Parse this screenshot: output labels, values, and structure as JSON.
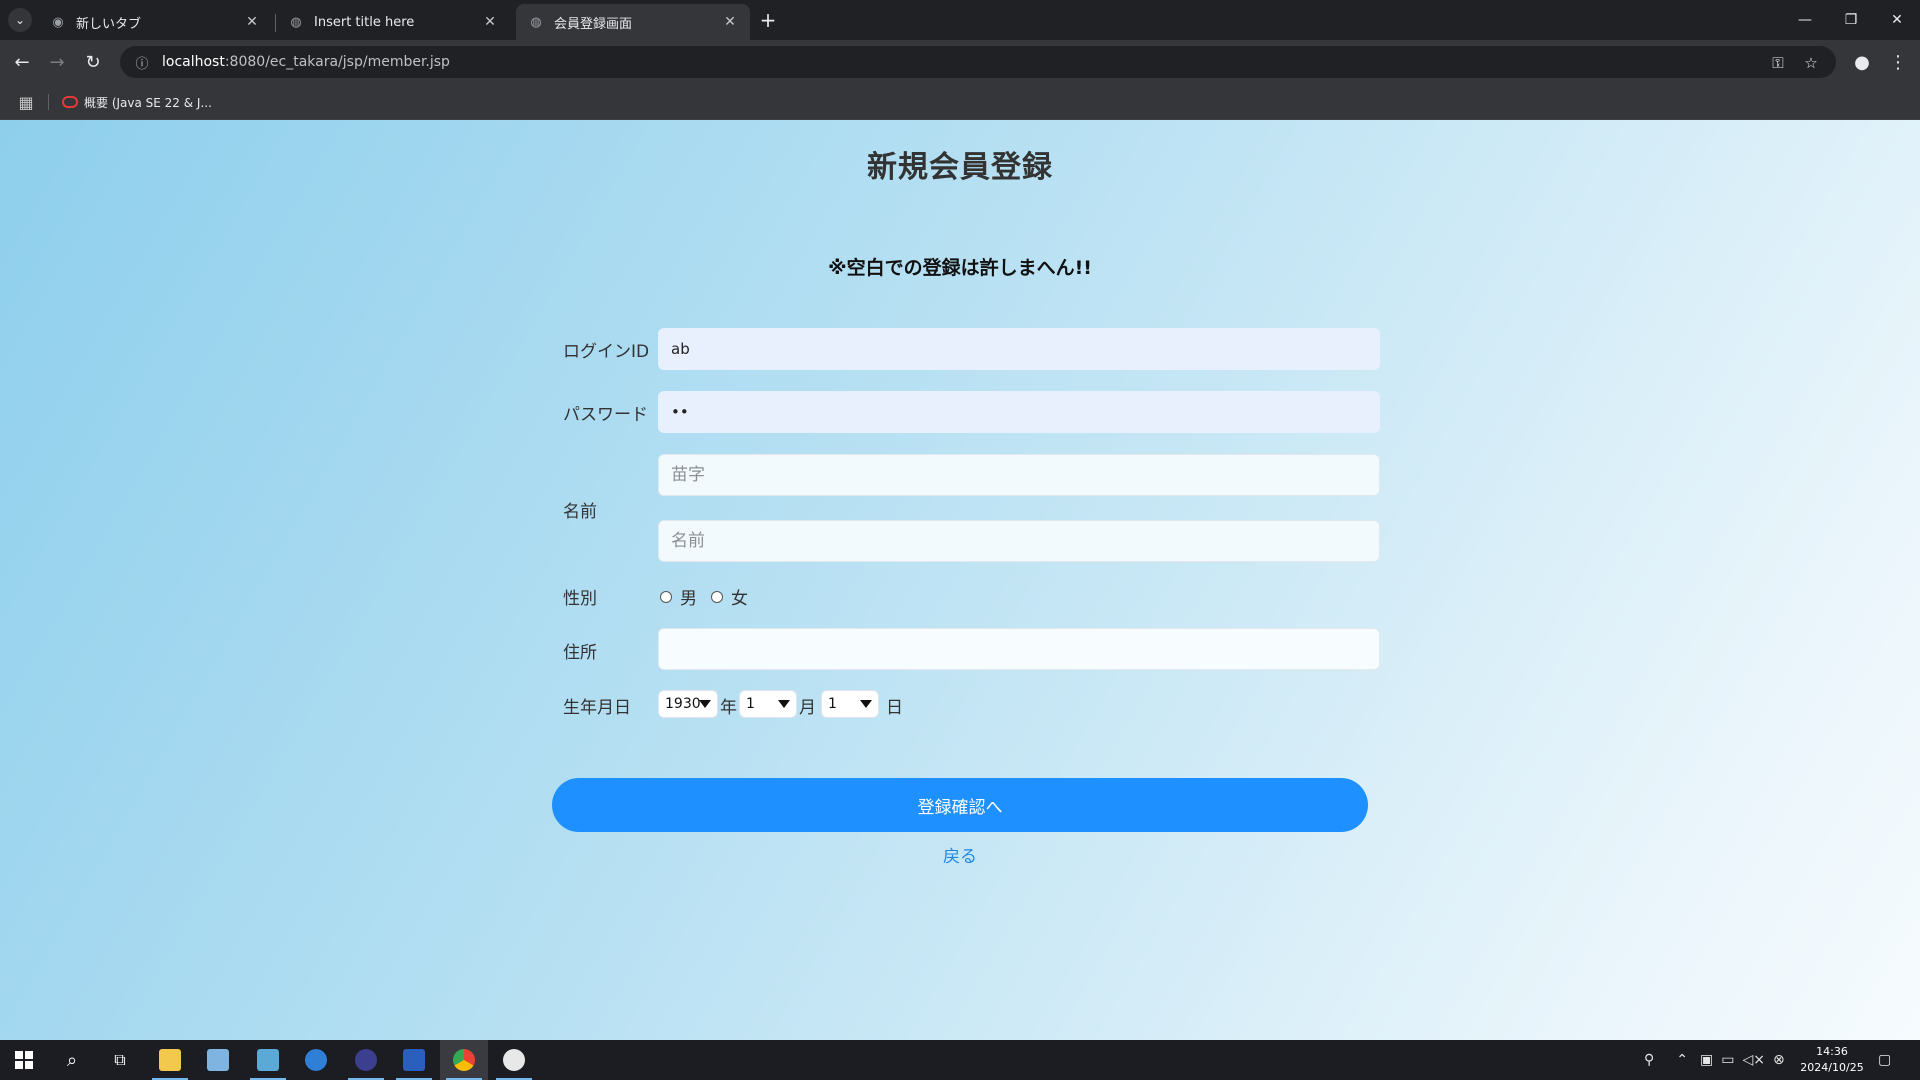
{
  "browser": {
    "tabs": [
      {
        "title": "新しいタブ",
        "icon": "chrome-icon",
        "active": false
      },
      {
        "title": "Insert title here",
        "icon": "globe-icon",
        "active": false
      },
      {
        "title": "会員登録画面",
        "icon": "globe-icon",
        "active": true
      }
    ],
    "url_host": "localhost",
    "url_path": ":8080/ec_takara/jsp/member.jsp",
    "bookmark": "概要 (Java SE 22 & J..."
  },
  "page": {
    "title": "新規会員登録",
    "warning": "※空白での登録は許しまへん!!",
    "form": {
      "login_label": "ログインID",
      "login_value": "ab",
      "password_label": "パスワード",
      "password_value": "••",
      "name_label": "名前",
      "surname_placeholder": "苗字",
      "firstname_placeholder": "名前",
      "gender_label": "性別",
      "gender_male": "男",
      "gender_female": "女",
      "address_label": "住所",
      "address_value": "",
      "birth_label": "生年月日",
      "year_value": "1930",
      "year_unit": "年",
      "month_value": "1",
      "month_unit": "月",
      "day_value": "1",
      "day_unit": "日"
    },
    "submit_label": "登録確認へ",
    "back_label": "戻る"
  },
  "taskbar": {
    "time": "14:36",
    "date": "2024/10/25"
  },
  "colors": {
    "submit": "#1e90ff",
    "link": "#1e88e5",
    "autofill": "#e8f0fe"
  }
}
